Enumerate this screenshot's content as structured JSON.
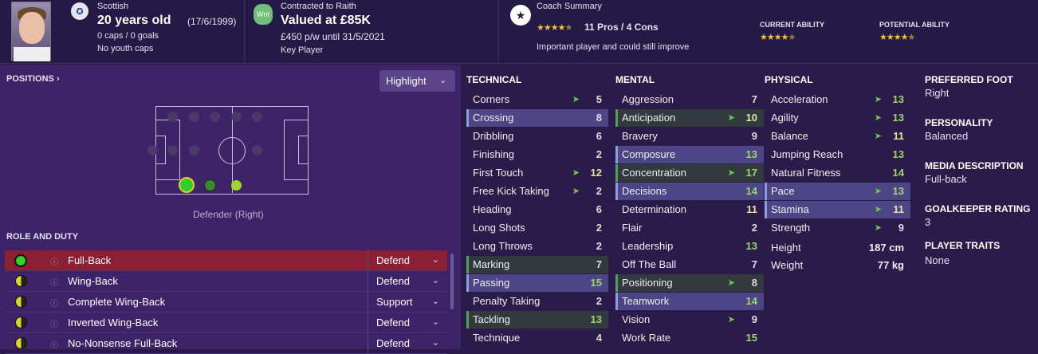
{
  "header": {
    "nationality": "Scottish",
    "age": "20 years old",
    "dob": "(17/6/1999)",
    "caps": "0 caps / 0 goals",
    "youth": "No youth caps",
    "club_badge": "Wnt",
    "contract": "Contracted to Raith",
    "value": "Valued at £85K",
    "wage": "£450 p/w until 31/5/2021",
    "status": "Key Player",
    "coach_label": "Coach Summary",
    "pros_cons": "11 Pros / 4 Cons",
    "coach_stars": 4.5,
    "coach_note": "Important player and could still improve",
    "ca_label": "CURRENT ABILITY",
    "ca_stars": 4.5,
    "pa_label": "POTENTIAL ABILITY",
    "pa_stars": 4.5
  },
  "positions": {
    "title": "POSITIONS ›",
    "highlight": "Highlight",
    "position_label": "Defender (Right)"
  },
  "roles": {
    "title": "ROLE AND DUTY",
    "items": [
      {
        "name": "Full-Back",
        "duty": "Defend",
        "selected": true
      },
      {
        "name": "Wing-Back",
        "duty": "Defend"
      },
      {
        "name": "Complete Wing-Back",
        "duty": "Support"
      },
      {
        "name": "Inverted Wing-Back",
        "duty": "Defend"
      },
      {
        "name": "No-Nonsense Full-Back",
        "duty": "Defend"
      }
    ]
  },
  "technical": {
    "title": "TECHNICAL",
    "items": [
      {
        "name": "Corners",
        "value": "5",
        "up": true
      },
      {
        "name": "Crossing",
        "value": "8",
        "hl": true
      },
      {
        "name": "Dribbling",
        "value": "6"
      },
      {
        "name": "Finishing",
        "value": "2"
      },
      {
        "name": "First Touch",
        "value": "12",
        "up": true
      },
      {
        "name": "Free Kick Taking",
        "value": "2",
        "up": true
      },
      {
        "name": "Heading",
        "value": "6"
      },
      {
        "name": "Long Shots",
        "value": "2"
      },
      {
        "name": "Long Throws",
        "value": "2"
      },
      {
        "name": "Marking",
        "value": "7",
        "gr": true
      },
      {
        "name": "Passing",
        "value": "15",
        "hl": true
      },
      {
        "name": "Penalty Taking",
        "value": "2"
      },
      {
        "name": "Tackling",
        "value": "13",
        "gr": true
      },
      {
        "name": "Technique",
        "value": "4"
      }
    ]
  },
  "mental": {
    "title": "MENTAL",
    "items": [
      {
        "name": "Aggression",
        "value": "7"
      },
      {
        "name": "Anticipation",
        "value": "10",
        "up": true,
        "gr": true
      },
      {
        "name": "Bravery",
        "value": "9"
      },
      {
        "name": "Composure",
        "value": "13",
        "hl": true
      },
      {
        "name": "Concentration",
        "value": "17",
        "up": true,
        "gr": true
      },
      {
        "name": "Decisions",
        "value": "14",
        "hl": true
      },
      {
        "name": "Determination",
        "value": "11"
      },
      {
        "name": "Flair",
        "value": "2"
      },
      {
        "name": "Leadership",
        "value": "13"
      },
      {
        "name": "Off The Ball",
        "value": "7"
      },
      {
        "name": "Positioning",
        "value": "8",
        "up": true,
        "gr": true
      },
      {
        "name": "Teamwork",
        "value": "14",
        "hl": true
      },
      {
        "name": "Vision",
        "value": "9",
        "up": true
      },
      {
        "name": "Work Rate",
        "value": "15"
      }
    ]
  },
  "physical": {
    "title": "PHYSICAL",
    "items": [
      {
        "name": "Acceleration",
        "value": "13",
        "up": true
      },
      {
        "name": "Agility",
        "value": "13",
        "up": true
      },
      {
        "name": "Balance",
        "value": "11",
        "up": true
      },
      {
        "name": "Jumping Reach",
        "value": "13"
      },
      {
        "name": "Natural Fitness",
        "value": "14"
      },
      {
        "name": "Pace",
        "value": "13",
        "up": true,
        "hl": true
      },
      {
        "name": "Stamina",
        "value": "11",
        "up": true,
        "hl": true
      },
      {
        "name": "Strength",
        "value": "9",
        "up": true
      },
      {
        "name": "Height",
        "value": "187 cm"
      },
      {
        "name": "Weight",
        "value": "77 kg"
      }
    ]
  },
  "side": {
    "foot_label": "PREFERRED FOOT",
    "foot": "Right",
    "personality_label": "PERSONALITY",
    "personality": "Balanced",
    "media_label": "MEDIA DESCRIPTION",
    "media": "Full-back",
    "gk_label": "GOALKEEPER RATING",
    "gk": "3",
    "traits_label": "PLAYER TRAITS",
    "traits": "None"
  },
  "colors": {
    "accent": "#8b2035",
    "highlight_row": "#4d4585",
    "up_arrow": "#6fd04a",
    "star": "#f2c230"
  }
}
